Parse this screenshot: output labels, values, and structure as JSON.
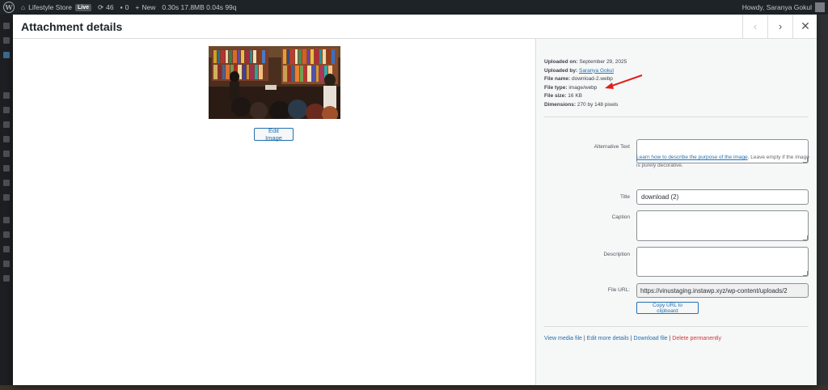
{
  "adminbar": {
    "site_name": "Lifestyle Store",
    "env_badge": "Live",
    "updates_count": "46",
    "comments_count": "0",
    "new_label": "New",
    "perf": "0.30s  17.8MB  0.04s  99q",
    "greeting": "Howdy, Saranya Gokul"
  },
  "modal": {
    "title": "Attachment details",
    "prev_icon": "‹",
    "next_icon": "›",
    "close_icon": "✕"
  },
  "preview": {
    "edit_button": "Edit Image"
  },
  "meta": {
    "uploaded_on_label": "Uploaded on:",
    "uploaded_on": "September 29, 2025",
    "uploaded_by_label": "Uploaded by:",
    "uploaded_by": "Saranya Gokul",
    "file_name_label": "File name:",
    "file_name": "download-2.webp",
    "file_type_label": "File type:",
    "file_type": "image/webp",
    "file_size_label": "File size:",
    "file_size": "16 KB",
    "dimensions_label": "Dimensions:",
    "dimensions": "270 by 148 pixels"
  },
  "form": {
    "alt_label": "Alternative Text",
    "alt_value": "",
    "alt_help_link": "Learn how to describe the purpose of the image",
    "alt_help_text": ". Leave empty if the image is purely decorative.",
    "title_label": "Title",
    "title_value": "download (2)",
    "caption_label": "Caption",
    "caption_value": "",
    "description_label": "Description",
    "description_value": "",
    "url_label": "File URL:",
    "url_value": "https://vinustaging.instawp.xyz/wp-content/uploads/2",
    "copy_button": "Copy URL to clipboard"
  },
  "actions": {
    "view": "View media file",
    "edit_more": "Edit more details",
    "download": "Download file",
    "delete": "Delete permanently",
    "separator": " | "
  },
  "colors": {
    "accent": "#2271b1",
    "danger": "#d63638",
    "annotation_arrow": "#e0201b"
  }
}
